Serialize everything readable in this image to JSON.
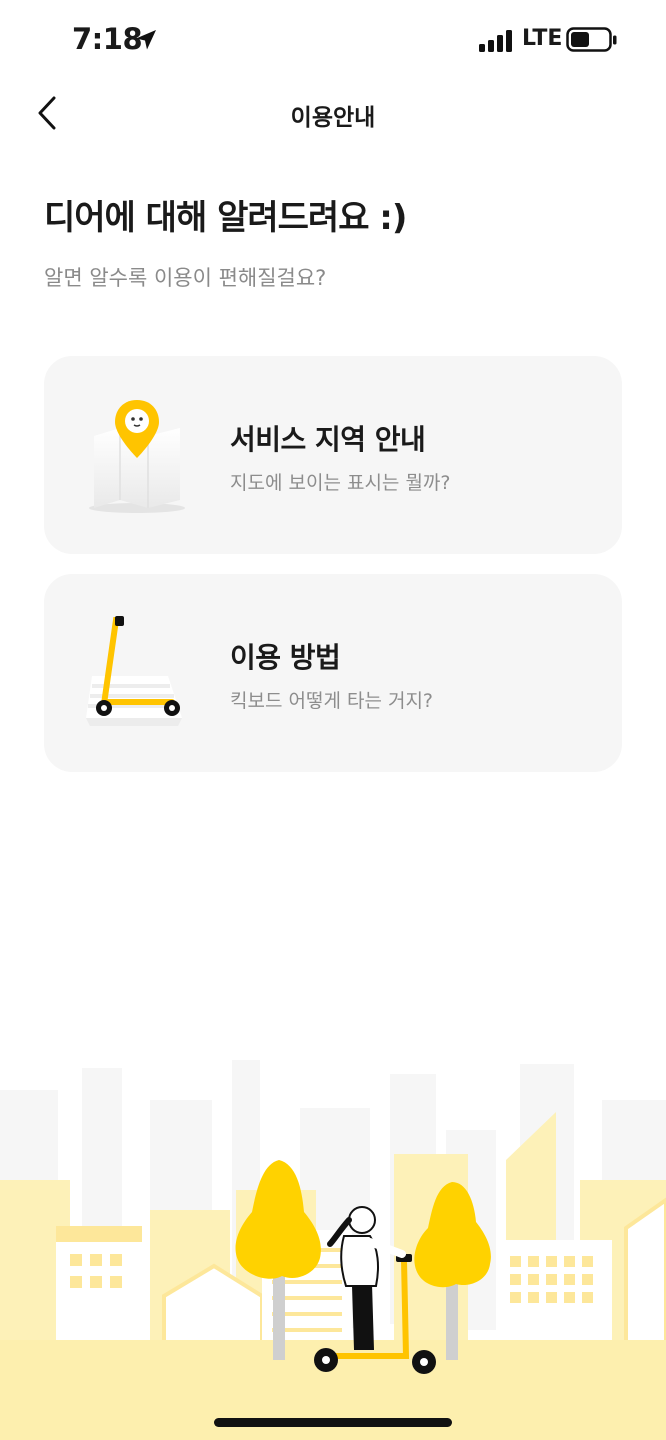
{
  "status_bar": {
    "time": "7:18",
    "network": "LTE"
  },
  "nav": {
    "title": "이용안내"
  },
  "intro": {
    "headline": "디어에 대해 알려드려요 :)",
    "subhead": "알면 알수록 이용이 편해질걸요?"
  },
  "cards": [
    {
      "title": "서비스 지역 안내",
      "description": "지도에 보이는 표시는 뭘까?",
      "icon": "map-pin-icon"
    },
    {
      "title": "이용 방법",
      "description": "킥보드 어떻게 타는 거지?",
      "icon": "scooter-icon"
    }
  ],
  "colors": {
    "accent": "#FFD000",
    "card_bg": "#F6F6F6",
    "muted_text": "#8D8D8D",
    "city_light": "#FDF1B8"
  }
}
